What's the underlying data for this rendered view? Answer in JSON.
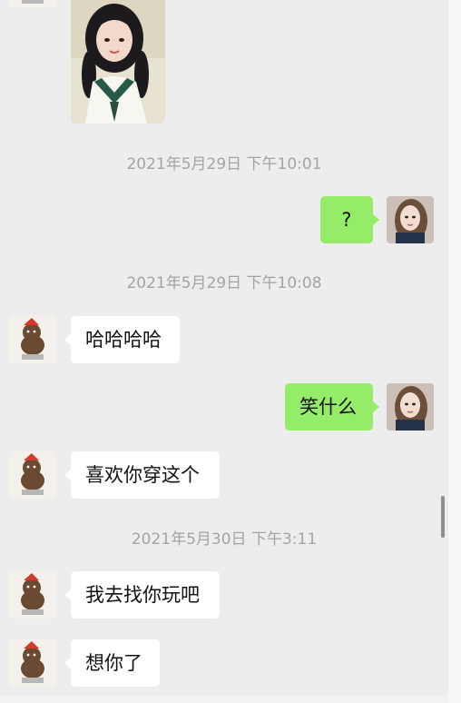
{
  "chat": {
    "messages": [
      {
        "type": "image",
        "sender": "contact",
        "content": "photo-of-girl"
      },
      {
        "type": "timestamp",
        "text": "2021年5月29日 下午10:01"
      },
      {
        "type": "text",
        "sender": "me",
        "text": "?"
      },
      {
        "type": "timestamp",
        "text": "2021年5月29日 下午10:08"
      },
      {
        "type": "text",
        "sender": "contact",
        "text": "哈哈哈哈"
      },
      {
        "type": "text",
        "sender": "me",
        "text": "笑什么"
      },
      {
        "type": "text",
        "sender": "contact",
        "text": "喜欢你穿这个"
      },
      {
        "type": "timestamp",
        "text": "2021年5月30日 下午3:11"
      },
      {
        "type": "text",
        "sender": "contact",
        "text": "我去找你玩吧"
      },
      {
        "type": "text",
        "sender": "contact",
        "text": "想你了"
      }
    ]
  },
  "colors": {
    "background": "#ededed",
    "incoming_bubble": "#ffffff",
    "outgoing_bubble": "#95ec69",
    "timestamp_text": "#a4a4a4"
  }
}
